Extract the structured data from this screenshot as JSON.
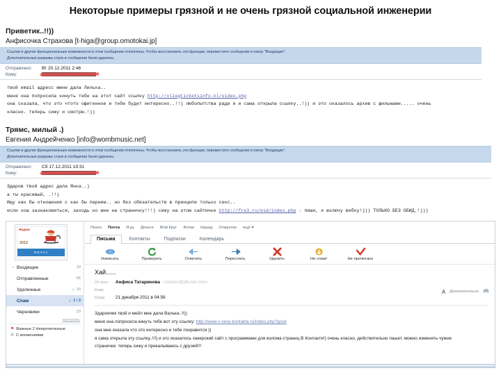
{
  "slide": {
    "title": "Некоторые примеры грязной и не очень грязной социальной инженерии"
  },
  "email1": {
    "subject": "Приветик..!!))",
    "from": "Анфисочка Страхова [t-higa@group.omotokai.jp]",
    "banner_line1": "Ссылки и другие функциональные возможности в этом сообщении отключены. Чтобы восстановить эти функции, переместите сообщение в папку \"Входящие\".",
    "banner_line2": "Дополнительные разрывы строк в сообщении были удалены.",
    "sent_label": "Отправлено:",
    "sent_value": "Вт 20.12.2011 2:46",
    "to_label": "Кому:",
    "to_value": "",
    "body": [
      " твой email адресс ммне дала Лилька..",
      "меня она попросила кинуть тебе на этот сайт ссылку ",
      "она сказала, что это чтото офигенное и тебе будет интересно..!!) любопытства ради я и сама открыла ссылку..!)) и это оказалось архив с фильмами..... очень",
      "класно. теперь сижу и смотрю.!))"
    ],
    "body_link": "http://vliegticketsinfo.nl/video.php"
  },
  "email2": {
    "subject": "Трямс, милый .)",
    "from": "Евгения Андрейченко [info@wombmusic.net]",
    "banner_line1": "Ссылки и другие функциональные возможности в этом сообщении отключены. Чтобы восстановить эти функции, переместите сообщение в папку \"Входящие\".",
    "banner_line2": "Дополнительные разрывы строк в сообщении были удалены.",
    "sent_label": "Отправлено:",
    "sent_value": "Сб 17.12.2011 19:31",
    "to_label": "Кому:",
    "to_value": "",
    "body": [
      "Здаров твой адрес дала Янка..)",
      "а ты красивый, .!!)",
      "Ищу как бы отношения с как бы парнем.. но без обязательств в принципе только секс..",
      "если хош зазнакомиться, заходь ко мне на страничку!!!) сижу на этом сайтичке "
    ],
    "body_link": "http://fre3.ru/esd/index.php",
    "body_tail": " - пиши, я включу вебку!)))  ТОЛЬКО БЕЗ ОБИД.!)))"
  },
  "yandex": {
    "stamp": {
      "brand": "Яндекс",
      "year": "2012",
      "banner": "ПОЧТА"
    },
    "topnav": [
      {
        "label": "Поиск",
        "bold": false
      },
      {
        "label": "Почта",
        "bold": true
      },
      {
        "label": "Я.ру",
        "bold": false
      },
      {
        "label": "Деньги",
        "bold": false
      },
      {
        "label": "Мой Круг",
        "bold": false
      },
      {
        "label": "Фотки",
        "bold": false
      },
      {
        "label": "Народ",
        "bold": false
      },
      {
        "label": "Открытки",
        "bold": false
      },
      {
        "label": "ещё ▾",
        "bold": false
      }
    ],
    "tabs": [
      {
        "label": "Письма",
        "active": true
      },
      {
        "label": "Контакты",
        "active": false
      },
      {
        "label": "Подписки",
        "active": false
      },
      {
        "label": "Календарь",
        "active": false
      }
    ],
    "toolbar": [
      {
        "label": "Написать",
        "icon": "compose-icon"
      },
      {
        "label": "Проверить",
        "icon": "refresh-icon"
      },
      {
        "label": "Ответить",
        "icon": "reply-icon"
      },
      {
        "label": "Переслать",
        "icon": "forward-icon"
      },
      {
        "label": "Удалить",
        "icon": "delete-icon"
      },
      {
        "label": "Не спам!",
        "icon": "not-spam-icon"
      },
      {
        "label": "Не прочитано",
        "icon": "unread-icon"
      }
    ],
    "folders": [
      {
        "name": "Входящие",
        "count": "10",
        "selected": false,
        "mark": false
      },
      {
        "name": "Отправленные",
        "count": "66",
        "selected": false,
        "mark": false
      },
      {
        "name": "Удаленные",
        "count": "19",
        "selected": false,
        "mark": true
      },
      {
        "name": "Спам",
        "count": "1 / 3",
        "selected": true,
        "mark": true
      },
      {
        "name": "Черновики",
        "count": "23",
        "selected": false,
        "mark": false
      }
    ],
    "settings_link": "настроить",
    "tags": [
      {
        "label": "Важные 2  Непрочитанные",
        "icon": "flag-icon"
      },
      {
        "label": "С вложениями",
        "icon": "paperclip-icon"
      }
    ],
    "message": {
      "subject": "Хай......",
      "from_label": "От кого",
      "from_name": "Анфиса Татаринова",
      "from_addr": "<romanv@ptb.net.com>",
      "to_label": "Кому",
      "to_value": "",
      "date_label": "Когда",
      "date_value": "21 декабря 2011 в 04:56",
      "more_label": "Дополнительно",
      "font_icon": "font-size-icon",
      "print_icon": "print-icon",
      "body": [
        "Здароечик твой и мейл мне дала Валька..!!))",
        "меня она попросила кинуть тебе вот эту ссылку: ",
        "она мне оказала что это интересно и тебе понравится ))",
        "я сама открыла эту ссылку..!!!) и это оказалось хакерский сайт с программами для взлома страниц В Контакте!) очень класно, действительно пашет. можно изменять чужие",
        "странички. теперь сижу и прикалываюсь с друзей!!!"
      ],
      "body_link": "http://www.v-sexy-kontakte.ru/index.php?govk"
    }
  }
}
